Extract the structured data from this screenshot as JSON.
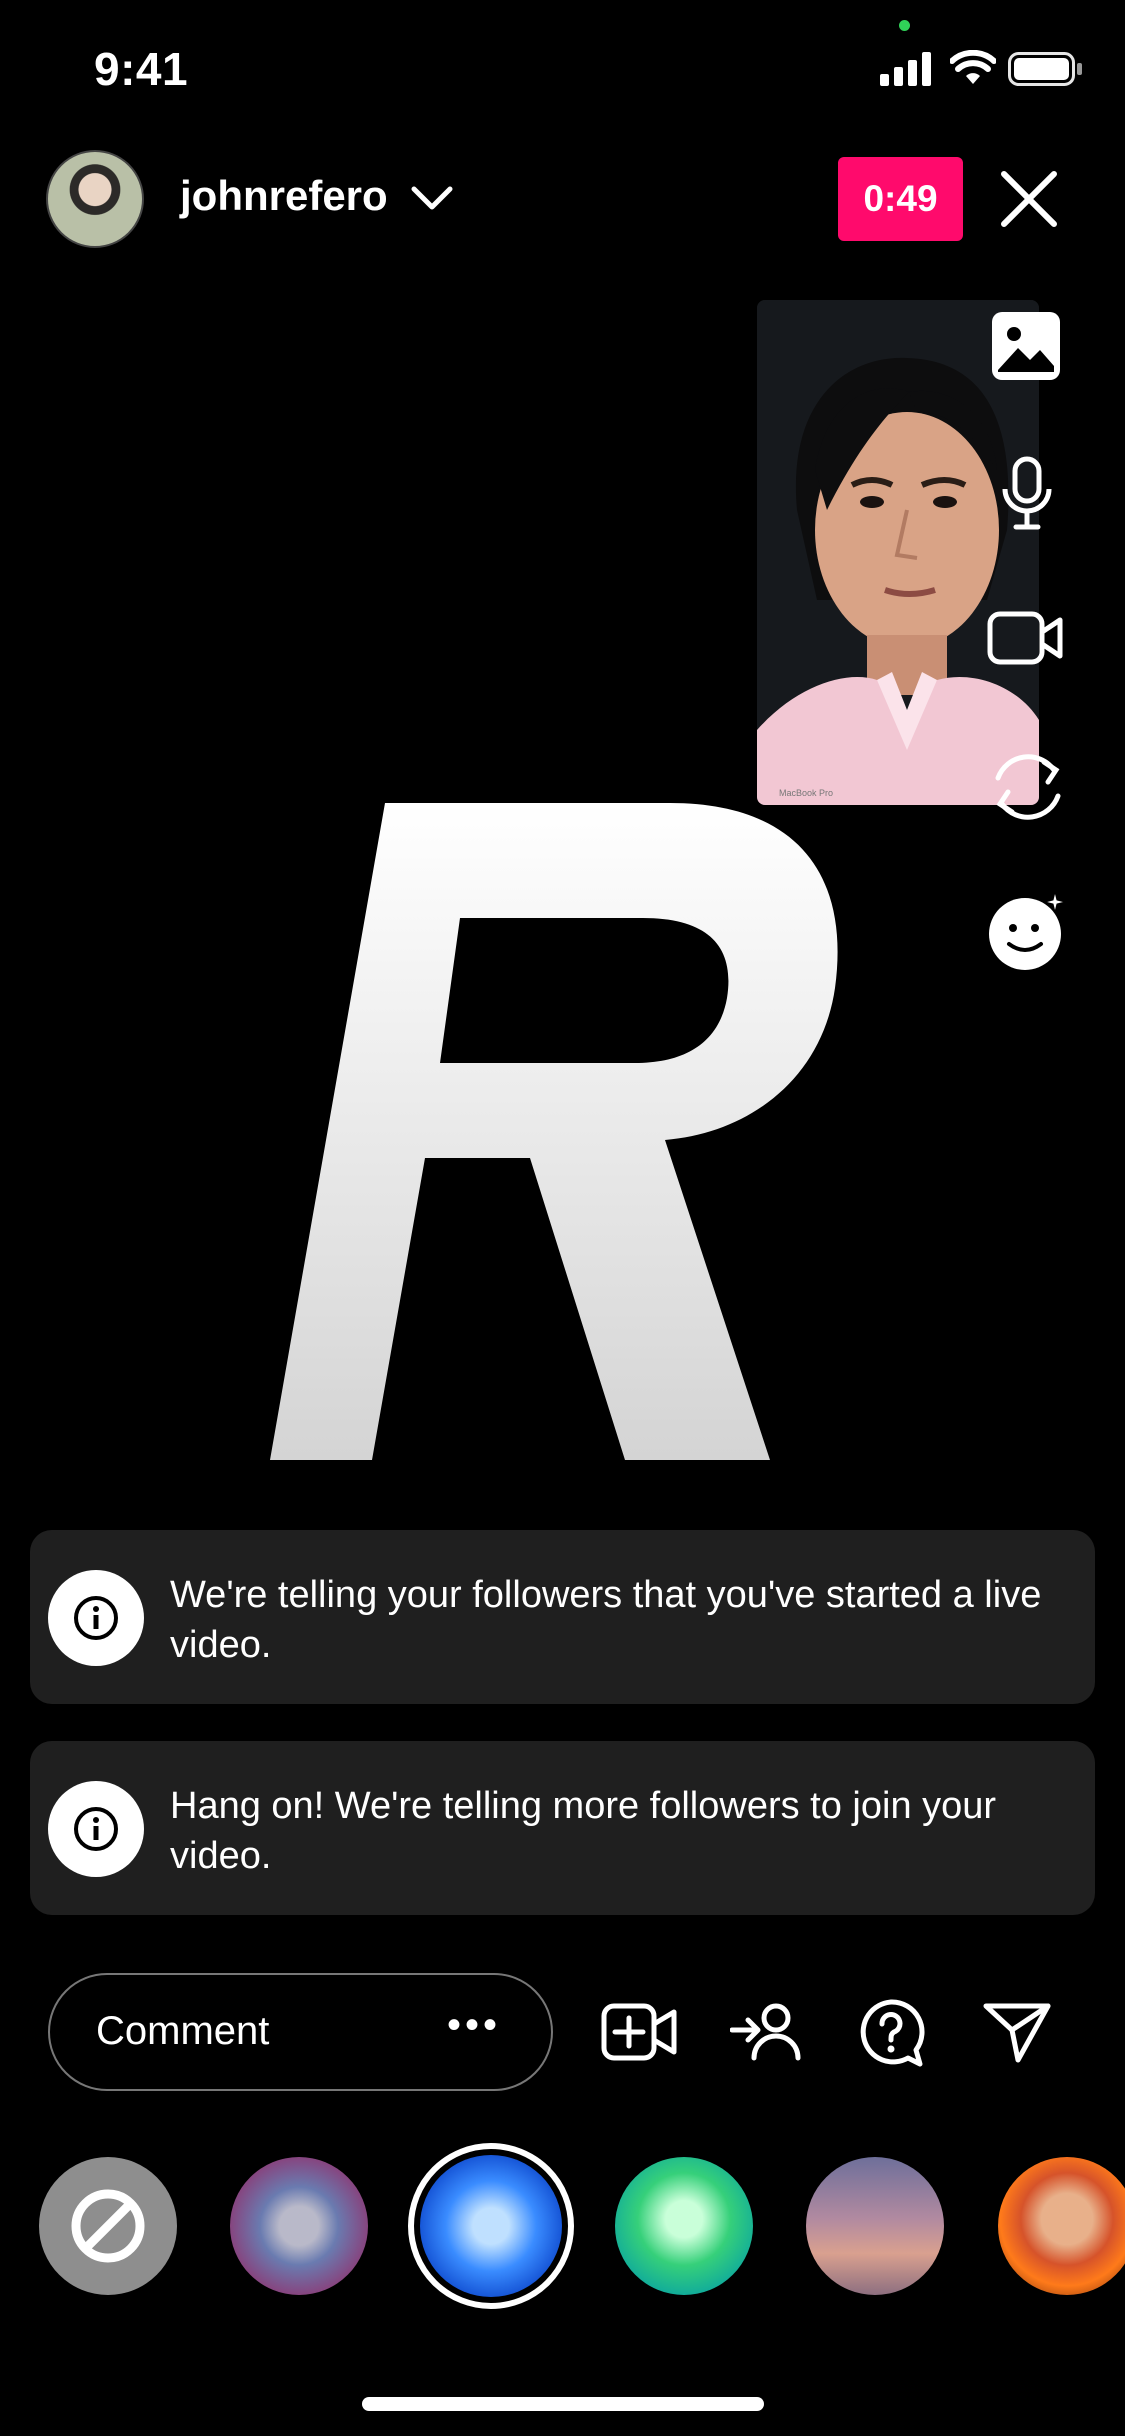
{
  "status_bar": {
    "time": "9:41"
  },
  "header": {
    "username": "johnrefero",
    "timer": "0:49"
  },
  "banners": [
    {
      "text": "We're telling your followers that you've started a live video."
    },
    {
      "text": "Hang on! We're telling more followers to join your video."
    }
  ],
  "composer": {
    "placeholder": "Comment",
    "more": "•••"
  },
  "side_tools": [
    "gallery-icon",
    "microphone-icon",
    "video-camera-icon",
    "flip-camera-icon",
    "effects-icon"
  ],
  "bottom_actions": [
    "add-guest-icon",
    "invite-icon",
    "question-icon",
    "send-icon"
  ],
  "filters": [
    "none",
    "dots-purple",
    "dots-blue",
    "dots-green",
    "sunset",
    "fire"
  ],
  "colors": {
    "accent": "#ff0a6c",
    "background": "#000000",
    "banner": "#1f1f1f"
  }
}
